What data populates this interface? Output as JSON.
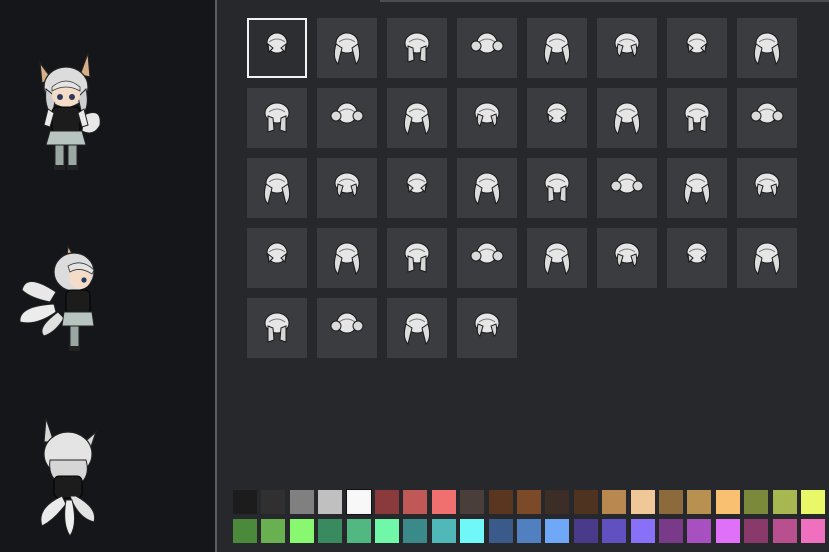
{
  "hair_styles": [
    {
      "style": "short-bob"
    },
    {
      "style": "long-twintails"
    },
    {
      "style": "pigtails"
    },
    {
      "style": "braided-buns"
    },
    {
      "style": "side-ponytail"
    },
    {
      "style": "twin-drills"
    },
    {
      "style": "short-curl"
    },
    {
      "style": "spiky-short"
    },
    {
      "style": "mid-length"
    },
    {
      "style": "cropped"
    },
    {
      "style": "rounded-bob"
    },
    {
      "style": "pixie"
    },
    {
      "style": "bowl"
    },
    {
      "style": "tiny-crop"
    },
    {
      "style": "long-straight"
    },
    {
      "style": "hime-long"
    },
    {
      "style": "ringlets"
    },
    {
      "style": "short-cropped"
    },
    {
      "style": "flowing-long"
    },
    {
      "style": "messy-short"
    },
    {
      "style": "tousled"
    },
    {
      "style": "shaggy"
    },
    {
      "style": "wolf-cut"
    },
    {
      "style": "spiky-up"
    },
    {
      "style": "topknot"
    },
    {
      "style": "swept-short"
    },
    {
      "style": "long-side-tail"
    },
    {
      "style": "wavy-long"
    },
    {
      "style": "odango"
    },
    {
      "style": "side-swept-long"
    },
    {
      "style": "straight-bob"
    },
    {
      "style": "messy-bob"
    },
    {
      "style": "slick-back"
    },
    {
      "style": "wild-mane"
    },
    {
      "style": "braided-bob"
    },
    {
      "style": "fluffy-braids"
    }
  ],
  "selected_hair_index": 0,
  "palette": {
    "rows": [
      [
        "#1c1c1c",
        "#303030",
        "#808080",
        "#c0c0c0",
        "#f8f8f8",
        "#8a3a3a",
        "#c05858",
        "#f07070",
        "#4a3e3a",
        "#5a3620",
        "#7c4a28",
        "#3c2e26",
        "#4e3420",
        "#b88850",
        "#f0c898",
        "#8c6a3c",
        "#b89050",
        "#f8c070",
        "#7a8a3a",
        "#a8b850",
        "#e8f868"
      ],
      [
        "#4a8a3a",
        "#68b050",
        "#88f870",
        "#3a8a60",
        "#50b880",
        "#70f8a8",
        "#3a8a8a",
        "#50b8b8",
        "#70f8f8",
        "#3a5a8a",
        "#5080c0",
        "#70a8f8",
        "#4a3a8a",
        "#6050c0",
        "#8870f8",
        "#7a3a8a",
        "#a850c0",
        "#e070f8",
        "#8a3a6a",
        "#b85090",
        "#f070c0"
      ]
    ],
    "selected": {
      "row": 0,
      "col": 4
    }
  },
  "character_views": [
    {
      "view": "front",
      "icon": "character-front-icon"
    },
    {
      "view": "side",
      "icon": "character-side-icon"
    },
    {
      "view": "back",
      "icon": "character-back-icon"
    }
  ]
}
